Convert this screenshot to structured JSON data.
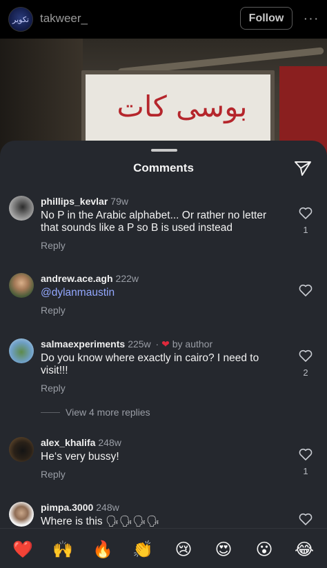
{
  "header": {
    "username": "takweer_",
    "avatar_text": "تكوير",
    "follow_label": "Follow",
    "more_label": "···"
  },
  "photo": {
    "sign_text": "بوسى كات"
  },
  "sheet": {
    "title": "Comments"
  },
  "comments": [
    {
      "username": "phillips_kevlar",
      "time": "79w",
      "text": "No P in the Arabic alphabet... Or rather no letter that sounds like a P so B is used instead",
      "reply": "Reply",
      "likes": "1"
    },
    {
      "username": "andrew.ace.agh",
      "time": "222w",
      "text": "@dylanmaustin",
      "reply": "Reply",
      "likes": ""
    },
    {
      "username": "salmaexperiments",
      "time": "225w",
      "by_author": "· ❤ by author",
      "text": "Do you know where exactly in cairo? I need to visit!!!",
      "reply": "Reply",
      "likes": "2",
      "view_replies": "View 4 more replies"
    },
    {
      "username": "alex_khalifa",
      "time": "248w",
      "text": "He‘s very bussy!",
      "reply": "Reply",
      "likes": "1"
    },
    {
      "username": "pimpa.3000",
      "time": "248w",
      "text": "Where is this 🗣🗣🗣🗣",
      "likes": ""
    }
  ],
  "emoji_bar": [
    "❤️",
    "🙌",
    "🔥",
    "👏",
    "😢",
    "😍",
    "😮",
    "😂"
  ],
  "colors": {
    "sheet_bg": "#25282e",
    "mention": "#93a8ff",
    "heart_red": "#e0293c"
  }
}
